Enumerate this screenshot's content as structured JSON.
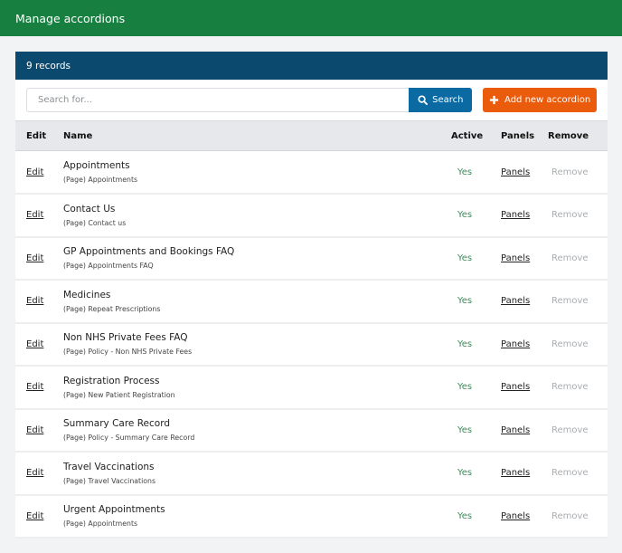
{
  "header": {
    "title": "Manage accordions"
  },
  "card": {
    "record_count": "9 records"
  },
  "toolbar": {
    "search_placeholder": "Search for...",
    "search_value": "",
    "search_label": "Search",
    "search_icon": "search-icon",
    "add_label": "Add new accordion",
    "add_icon": "plus-icon"
  },
  "colors": {
    "topbar": "#178040",
    "card_header": "#0b4a6e",
    "search_button": "#0b6aa2",
    "add_button": "#ea5b0c",
    "active_text": "#3f8a5c",
    "remove_text": "#a9adb1"
  },
  "table": {
    "columns": {
      "edit": "Edit",
      "name": "Name",
      "active": "Active",
      "panels": "Panels",
      "remove": "Remove"
    },
    "rows": [
      {
        "edit": "Edit",
        "name": "Appointments",
        "page": "(Page) Appointments",
        "active": "Yes",
        "panels": "Panels",
        "remove": "Remove"
      },
      {
        "edit": "Edit",
        "name": "Contact Us",
        "page": "(Page) Contact us",
        "active": "Yes",
        "panels": "Panels",
        "remove": "Remove"
      },
      {
        "edit": "Edit",
        "name": "GP Appointments and Bookings FAQ",
        "page": "(Page) Appointments FAQ",
        "active": "Yes",
        "panels": "Panels",
        "remove": "Remove"
      },
      {
        "edit": "Edit",
        "name": "Medicines",
        "page": "(Page) Repeat Prescriptions",
        "active": "Yes",
        "panels": "Panels",
        "remove": "Remove"
      },
      {
        "edit": "Edit",
        "name": "Non NHS Private Fees FAQ",
        "page": "(Page) Policy - Non NHS Private Fees",
        "active": "Yes",
        "panels": "Panels",
        "remove": "Remove"
      },
      {
        "edit": "Edit",
        "name": "Registration Process",
        "page": "(Page) New Patient Registration",
        "active": "Yes",
        "panels": "Panels",
        "remove": "Remove"
      },
      {
        "edit": "Edit",
        "name": "Summary Care Record",
        "page": "(Page) Policy - Summary Care Record",
        "active": "Yes",
        "panels": "Panels",
        "remove": "Remove"
      },
      {
        "edit": "Edit",
        "name": "Travel Vaccinations",
        "page": "(Page) Travel Vaccinations",
        "active": "Yes",
        "panels": "Panels",
        "remove": "Remove"
      },
      {
        "edit": "Edit",
        "name": "Urgent Appointments",
        "page": "(Page) Appointments",
        "active": "Yes",
        "panels": "Panels",
        "remove": "Remove"
      }
    ]
  }
}
